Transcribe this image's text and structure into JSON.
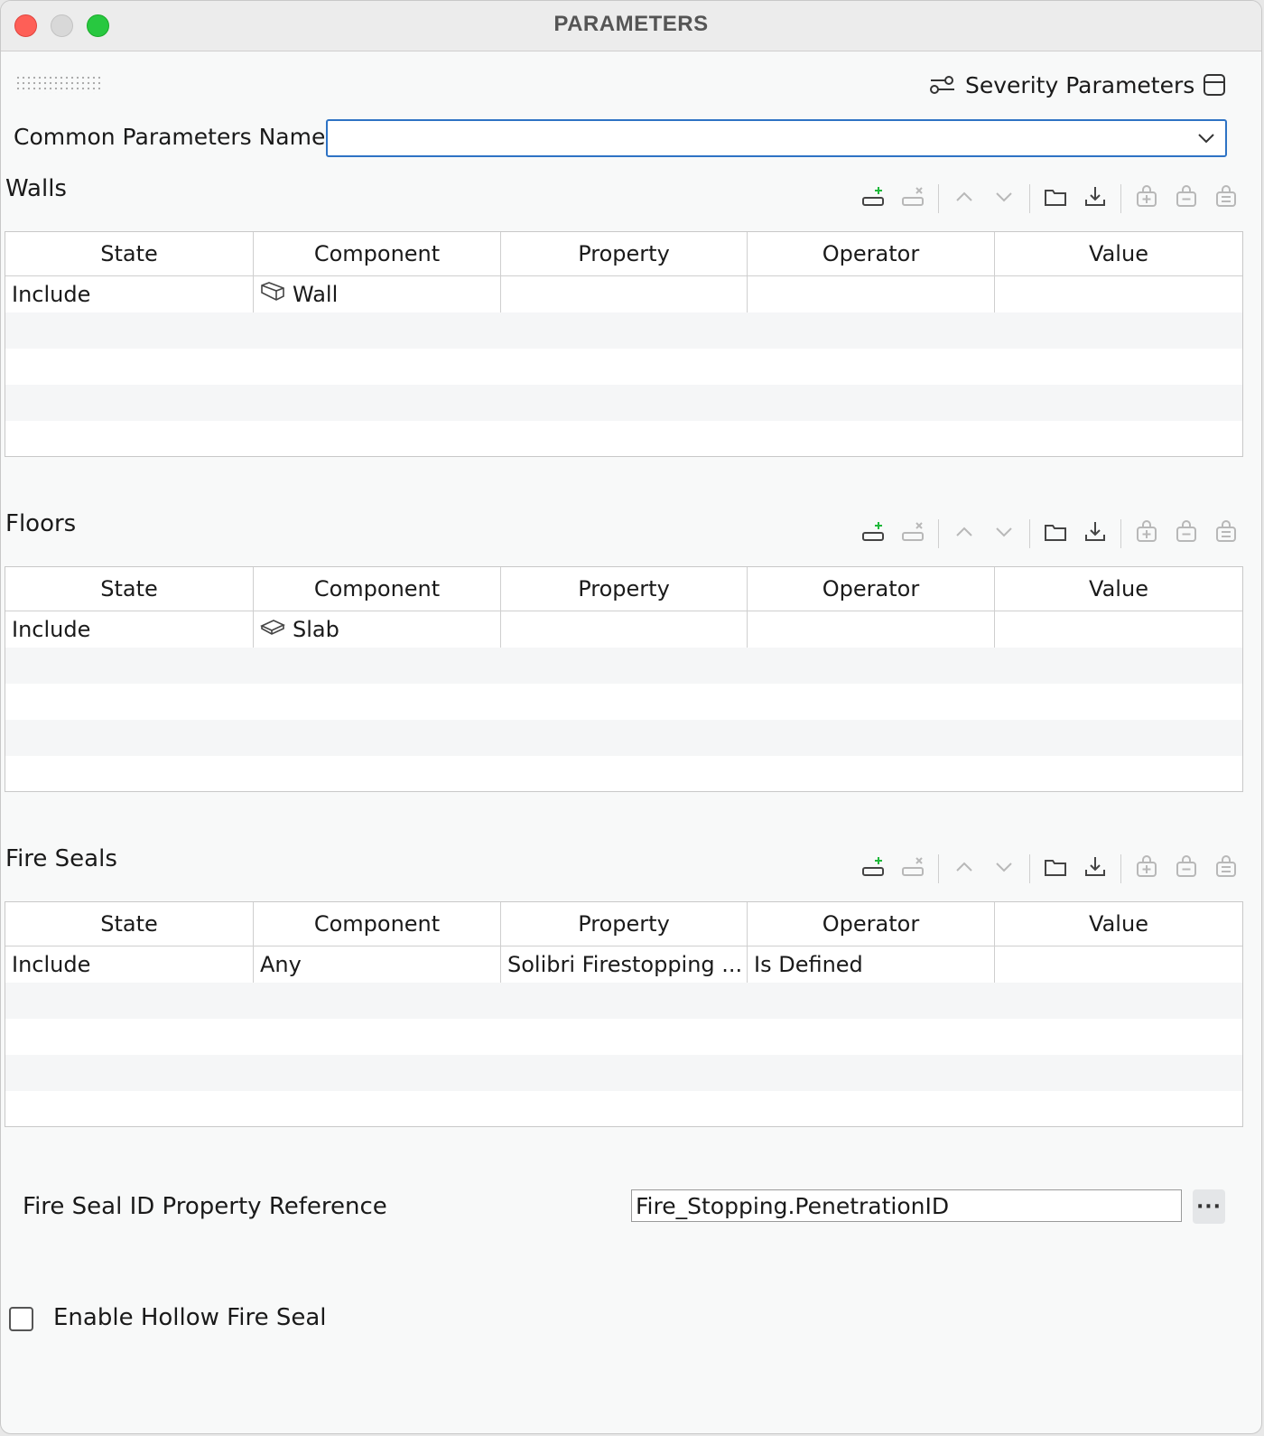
{
  "window": {
    "title": "PARAMETERS"
  },
  "header": {
    "severity_label": "Severity Parameters"
  },
  "common_parameters": {
    "label": "Common Parameters Name",
    "value": ""
  },
  "columns": [
    "State",
    "Component",
    "Property",
    "Operator",
    "Value"
  ],
  "sections": [
    {
      "title": "Walls",
      "rows": [
        {
          "state": "Include",
          "component": "Wall",
          "component_icon": "wall-icon",
          "property": "",
          "operator": "",
          "value": ""
        }
      ]
    },
    {
      "title": "Floors",
      "rows": [
        {
          "state": "Include",
          "component": "Slab",
          "component_icon": "slab-icon",
          "property": "",
          "operator": "",
          "value": ""
        }
      ]
    },
    {
      "title": "Fire Seals",
      "rows": [
        {
          "state": "Include",
          "component": "Any",
          "component_icon": "",
          "property": "Solibri Firestopping ...",
          "operator": "Is Defined",
          "value": ""
        }
      ]
    }
  ],
  "fire_seal_id": {
    "label": "Fire Seal ID Property Reference",
    "value": "Fire_Stopping.PenetrationID",
    "more_label": "···"
  },
  "hollow": {
    "label": "Enable Hollow Fire Seal",
    "checked": false
  },
  "colors": {
    "accent": "#2e73c4",
    "add_green": "#1fb83a",
    "close": "#fe5f57",
    "max": "#28c840"
  }
}
